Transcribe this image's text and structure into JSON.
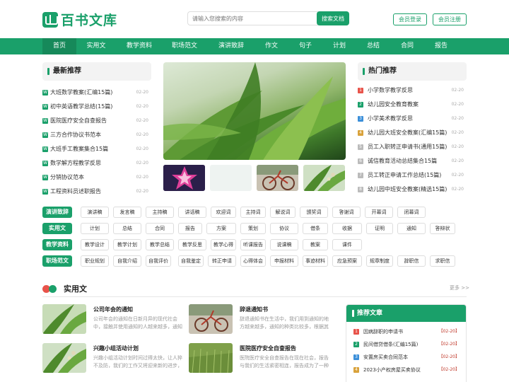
{
  "brand": {
    "name": "百书文库",
    "accent": "#1aa06a"
  },
  "search": {
    "placeholder": "请输入您搜索的内容",
    "button": "搜索文档"
  },
  "header": {
    "login": "会员登录",
    "register": "会员注册"
  },
  "nav": [
    "首页",
    "实用文",
    "教学资料",
    "职场范文",
    "演讲致辞",
    "作文",
    "句子",
    "计划",
    "总结",
    "合同",
    "报告"
  ],
  "latest": {
    "title": "最新推荐",
    "items": [
      {
        "label": "大班数学教案(汇编15篇)",
        "date": "02-20"
      },
      {
        "label": "初中英语教学总结(15篇)",
        "date": "02-20"
      },
      {
        "label": "医院医疗安全自查报告",
        "date": "02-20"
      },
      {
        "label": "三方合作协议书范本",
        "date": "02-20"
      },
      {
        "label": "大班手工教案集合15篇",
        "date": "02-20"
      },
      {
        "label": "数学解方程教学反思",
        "date": "02-20"
      },
      {
        "label": "分销协议范本",
        "date": "02-20"
      },
      {
        "label": "工程资料员述职报告",
        "date": "02-20"
      }
    ]
  },
  "hot": {
    "title": "热门推荐",
    "items": [
      {
        "num": "1",
        "label": "小学数学教学反思",
        "date": "02-20",
        "color": "#e8534a"
      },
      {
        "num": "2",
        "label": "幼儿园安全教育教案",
        "date": "02-20",
        "color": "#1aa06a"
      },
      {
        "num": "3",
        "label": "小学美术教学反思",
        "date": "02-20",
        "color": "#3b8fd9"
      },
      {
        "num": "4",
        "label": "幼儿园大班安全教案(汇编15篇)",
        "date": "02-20",
        "color": "#d9a23b"
      },
      {
        "num": "5",
        "label": "员工入职转正申请书(通用15篇)",
        "date": "02-20",
        "color": "#bbbbbb"
      },
      {
        "num": "6",
        "label": "诚信教育活动总结集合15篇",
        "date": "02-20",
        "color": "#bbbbbb"
      },
      {
        "num": "7",
        "label": "员工转正申请工作总结(15篇)",
        "date": "02-20",
        "color": "#bbbbbb"
      },
      {
        "num": "8",
        "label": "幼儿园中班安全教案(精选15篇)",
        "date": "02-20",
        "color": "#bbbbbb"
      }
    ]
  },
  "tag_rows": [
    {
      "label": "演讲致辞",
      "tags": [
        "演讲稿",
        "发言稿",
        "主持稿",
        "讲话稿",
        "欢迎词",
        "主持词",
        "解说词",
        "颁奖词",
        "答谢词",
        "开幕词",
        "闭幕词"
      ]
    },
    {
      "label": "实用文",
      "tags": [
        "计划",
        "总结",
        "合同",
        "报告",
        "方案",
        "策划",
        "协议",
        "借条",
        "收据",
        "证明",
        "通知",
        "答辩状"
      ]
    },
    {
      "label": "教学资料",
      "tags": [
        "教学设计",
        "教学计划",
        "教学总结",
        "教学反思",
        "教学心得",
        "听课报告",
        "说课稿",
        "教案",
        "课件"
      ]
    },
    {
      "label": "职场范文",
      "tags": [
        "职业规划",
        "自我介绍",
        "自我评价",
        "自我鉴定",
        "转正申请",
        "心得体会",
        "申报材料",
        "事迹材料",
        "应急预案",
        "规章制度",
        "辞职信",
        "求职信"
      ]
    }
  ],
  "section": {
    "title": "实用文",
    "more": "更多 >>",
    "articles": [
      {
        "title": "公司年会的通知",
        "desc": "公司年会的通知在日新月异的现代社会中，接触并使用通知的人越来越多，通知"
      },
      {
        "title": "辞退通知书",
        "desc": "辞退通知书在生活中，我们用到通知的地方越来越多，通知的种类比较多，根据其"
      },
      {
        "title": "兴趣小组活动计划",
        "desc": "兴趣小组活动计划时间过得太快，让人猝不及防，我们的工作又将迎来新的进步，"
      },
      {
        "title": "医院医疗安全自查报告",
        "desc": "医院医疗安全自查报告在现在社会，报告与我们的生活紧密相连，报告成为了一种"
      }
    ]
  },
  "recommend": {
    "title": "推荐文章",
    "items": [
      {
        "num": "1",
        "label": "因病辞职的申请书",
        "date": "【02-20】",
        "color": "#e8534a"
      },
      {
        "num": "2",
        "label": "民间借贷借条(汇编15篇)",
        "date": "【02-20】",
        "color": "#1aa06a"
      },
      {
        "num": "3",
        "label": "安置房买卖合同范本",
        "date": "【02-20】",
        "color": "#3b8fd9"
      },
      {
        "num": "4",
        "label": "2023小产权房屋买卖协议",
        "date": "【02-20】",
        "color": "#d9a23b"
      }
    ]
  }
}
